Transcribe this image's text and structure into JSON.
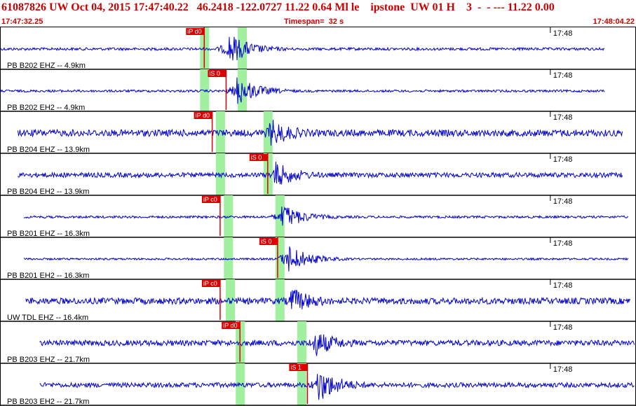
{
  "header": {
    "event_line": "61087826 UW Oct 04, 2015 17:47:40.22   46.2418 -122.0727 11.22 0.64 Ml le    ipstone  UW 01 H    3  -  - --- 11.22 0.00",
    "start_time": "17:47:32.25",
    "timespan": "Timespan=  32 s",
    "end_time": "17:48:04.22"
  },
  "chart_data": {
    "type": "line",
    "x_unit": "s",
    "x_range": [
      0,
      32
    ],
    "minute_marker_label": "17:48",
    "minute_marker_time": 27.75,
    "colors": {
      "trace": "#0000cc",
      "pick": "#dd0000",
      "window": "#a0f0a0",
      "frame": "#000000"
    },
    "traces": [
      {
        "label": "PB B202 EHZ -- 4.9km",
        "start": 0,
        "end": 30.5,
        "noise": 0.07,
        "pick": {
          "label": "iP d0",
          "time": 10.3
        },
        "windows": [
          10.3,
          12.2
        ],
        "burst_time": 11.5,
        "burst_amp": 0.85
      },
      {
        "label": "PB B202 EH2 -- 4.9km",
        "start": 0,
        "end": 30.5,
        "noise": 0.06,
        "pick": {
          "label": "iS 0",
          "time": 11.4
        },
        "windows": [
          10.3,
          12.2
        ],
        "burst_time": 11.9,
        "burst_amp": 0.8
      },
      {
        "label": "PB B204 EHZ -- 13.9km",
        "start": 0.9,
        "end": 31.4,
        "noise": 0.17,
        "pick": {
          "label": "iP d0",
          "time": 10.7
        },
        "windows": [
          11.1,
          13.5
        ],
        "burst_time": 13.5,
        "burst_amp": 0.75
      },
      {
        "label": "PB B204 EH2 -- 13.9km",
        "start": 0.9,
        "end": 31.4,
        "noise": 0.12,
        "pick": {
          "label": "iS 0",
          "time": 13.5
        },
        "windows": [
          11.1,
          13.5
        ],
        "burst_time": 13.8,
        "burst_amp": 0.7
      },
      {
        "label": "PB B201 EHZ -- 16.3km",
        "start": 1.2,
        "end": 31.7,
        "noise": 0.06,
        "pick": {
          "label": "iP c0",
          "time": 11.1
        },
        "windows": [
          11.5,
          14.1
        ],
        "burst_time": 14.2,
        "burst_amp": 0.7
      },
      {
        "label": "PB B201 EH2 -- 16.3km",
        "start": 1.2,
        "end": 31.7,
        "noise": 0.05,
        "pick": {
          "label": "iS 0",
          "time": 14.0
        },
        "windows": [
          11.5,
          14.1
        ],
        "burst_time": 14.4,
        "burst_amp": 0.85
      },
      {
        "label": "UW TDL EHZ -- 16.4km",
        "start": 1.3,
        "end": 31.8,
        "noise": 0.16,
        "pick": {
          "label": "iP c0",
          "time": 11.1
        },
        "windows": [
          11.6,
          14.1
        ],
        "burst_time": 14.6,
        "burst_amp": 0.7
      },
      {
        "label": "PB B203 EHZ -- 21.7km",
        "start": 2.0,
        "end": 32.0,
        "noise": 0.14,
        "pick": {
          "label": "iP d0",
          "time": 12.1
        },
        "windows": [
          12.1,
          15.2
        ],
        "burst_time": 15.8,
        "burst_amp": 0.7
      },
      {
        "label": "PB B203 EH2 -- 21.7km",
        "start": 2.0,
        "end": 32.0,
        "noise": 0.12,
        "pick": {
          "label": "iS 1",
          "time": 15.5
        },
        "windows": [
          12.1,
          15.2
        ],
        "burst_time": 16.0,
        "burst_amp": 0.9
      }
    ]
  }
}
